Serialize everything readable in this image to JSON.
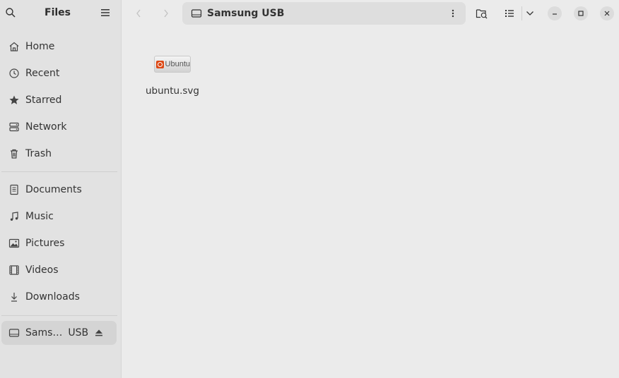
{
  "sidebar": {
    "title": "Files",
    "places": [
      {
        "label": "Home",
        "icon": "home-icon"
      },
      {
        "label": "Recent",
        "icon": "clock-icon"
      },
      {
        "label": "Starred",
        "icon": "star-icon"
      },
      {
        "label": "Network",
        "icon": "network-icon"
      },
      {
        "label": "Trash",
        "icon": "trash-icon"
      }
    ],
    "bookmarks": [
      {
        "label": "Documents",
        "icon": "document-icon"
      },
      {
        "label": "Music",
        "icon": "music-icon"
      },
      {
        "label": "Pictures",
        "icon": "picture-icon"
      },
      {
        "label": "Videos",
        "icon": "video-icon"
      },
      {
        "label": "Downloads",
        "icon": "download-icon"
      }
    ],
    "device": {
      "label_start": "Sams…",
      "label_end": "USB",
      "icon": "drive-icon"
    }
  },
  "header": {
    "location": "Samsung USB"
  },
  "files": [
    {
      "name": "ubuntu.svg",
      "thumbnail_text": "Ubuntu"
    }
  ],
  "colors": {
    "window_bg": "#ebebeb",
    "sidebar_bg": "#e2e2e2",
    "active_item_bg": "#d4d4d4",
    "ubuntu_orange": "#dd4814"
  }
}
